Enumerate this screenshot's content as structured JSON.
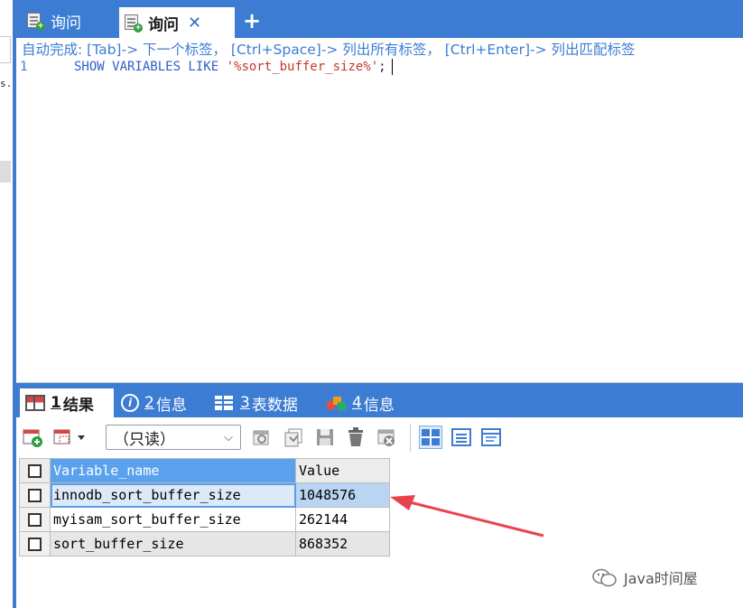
{
  "left_panel": {
    "fragment_text": "s."
  },
  "tabs": [
    {
      "label": "询问",
      "active": false
    },
    {
      "label": "询问",
      "active": true
    }
  ],
  "editor": {
    "hint": "自动完成: [Tab]-> 下一个标签， [Ctrl+Space]-> 列出所有标签， [Ctrl+Enter]-> 列出匹配标签",
    "line_number": "1",
    "keywords": "SHOW VARIABLES LIKE",
    "string_literal": "'%sort_buffer_size%'",
    "terminator": ";"
  },
  "result_tabs": [
    {
      "num": "1",
      "label": "结果",
      "active": true
    },
    {
      "num": "2",
      "label": "信息",
      "active": false
    },
    {
      "num": "3",
      "label": "表数据",
      "active": false
    },
    {
      "num": "4",
      "label": "信息",
      "active": false
    }
  ],
  "toolbar": {
    "mode_select": "（只读）"
  },
  "results": {
    "columns": [
      "Variable_name",
      "Value"
    ],
    "rows": [
      [
        "innodb_sort_buffer_size",
        "1048576"
      ],
      [
        "myisam_sort_buffer_size",
        "262144"
      ],
      [
        "sort_buffer_size",
        "868352"
      ]
    ],
    "selected_row": 0
  },
  "watermark": "Java时间屋",
  "colors": {
    "accent": "#3c7dd3",
    "arrow": "#e8434c",
    "header_highlight": "#5aa2ee"
  }
}
